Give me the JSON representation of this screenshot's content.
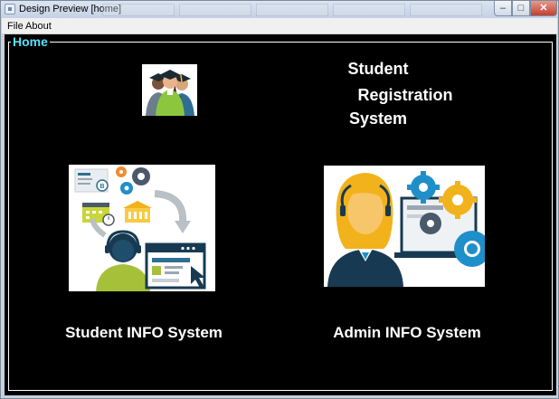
{
  "window": {
    "title": "Design Preview [home]"
  },
  "window_controls": {
    "minimize": "–",
    "maximize": "□",
    "close": "✕"
  },
  "menu": {
    "file": "File",
    "about": "About"
  },
  "panel": {
    "title": "Home"
  },
  "heading": {
    "line1": "Student",
    "line2": "Registration",
    "line3": "System"
  },
  "cards": {
    "student": {
      "caption": "Student INFO System"
    },
    "admin": {
      "caption": "Admin INFO System"
    }
  },
  "colors": {
    "panel_title": "#55e0ff",
    "background": "#000000",
    "text": "#ffffff"
  },
  "icons": {
    "logo": "graduates-icon",
    "student_image": "student-support-illustration",
    "admin_image": "admin-gears-illustration"
  }
}
